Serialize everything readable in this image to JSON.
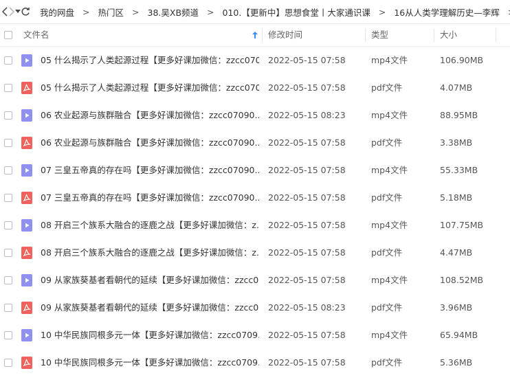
{
  "breadcrumb": [
    "我的网盘",
    "热门区",
    "38.吴XB频道",
    "010.【更新中】思想食堂丨大家通识课",
    "16从人类学理解历史—李辉"
  ],
  "columns": {
    "name": "文件名",
    "modified": "修改时间",
    "type": "类型",
    "size": "大小"
  },
  "files": [
    {
      "name": "05 什么揭示了人类起源过程【更多好课加微信：zzcc070...",
      "modified": "2022-05-15 07:58",
      "type": "mp4文件",
      "size": "106.90MB",
      "icon": "video-file-icon"
    },
    {
      "name": "05 什么揭示了人类起源过程【更多好课加微信：zzcc070...",
      "modified": "2022-05-15 07:58",
      "type": "pdf文件",
      "size": "4.07MB",
      "icon": "pdf-file-icon"
    },
    {
      "name": "06 农业起源与族群融合【更多好课加微信：zzcc07090...",
      "modified": "2022-05-15 08:23",
      "type": "mp4文件",
      "size": "88.95MB",
      "icon": "video-file-icon"
    },
    {
      "name": "06 农业起源与族群融合【更多好课加微信：zzcc07090...",
      "modified": "2022-05-15 07:58",
      "type": "pdf文件",
      "size": "3.38MB",
      "icon": "pdf-file-icon"
    },
    {
      "name": "07 三皇五帝真的存在吗【更多好课加微信：zzcc07090...",
      "modified": "2022-05-15 07:58",
      "type": "mp4文件",
      "size": "55.33MB",
      "icon": "video-file-icon"
    },
    {
      "name": "07 三皇五帝真的存在吗【更多好课加微信：zzcc07090...",
      "modified": "2022-05-15 07:58",
      "type": "pdf文件",
      "size": "5.18MB",
      "icon": "pdf-file-icon"
    },
    {
      "name": "08 开启三个族系大融合的逐鹿之战【更多好课加微信：z...",
      "modified": "2022-05-15 07:58",
      "type": "mp4文件",
      "size": "107.75MB",
      "icon": "video-file-icon"
    },
    {
      "name": "08 开启三个族系大融合的逐鹿之战【更多好课加微信：z...",
      "modified": "2022-05-15 07:58",
      "type": "pdf文件",
      "size": "4.47MB",
      "icon": "pdf-file-icon"
    },
    {
      "name": "09 从家族葵基者看朝代的延续【更多好课加微信：zzcc0...",
      "modified": "2022-05-15 07:58",
      "type": "mp4文件",
      "size": "108.52MB",
      "icon": "video-file-icon"
    },
    {
      "name": "09 从家族葵基者看朝代的延续【更多好课加微信：zzcc0...",
      "modified": "2022-05-15 08:23",
      "type": "pdf文件",
      "size": "3.96MB",
      "icon": "pdf-file-icon"
    },
    {
      "name": "10 中华民族同根多元一体【更多好课加微信：zzcc0709...",
      "modified": "2022-05-15 07:58",
      "type": "mp4文件",
      "size": "65.94MB",
      "icon": "video-file-icon"
    },
    {
      "name": "10 中华民族同根多元一体【更多好课加微信：zzcc0709...",
      "modified": "2022-05-15 07:58",
      "type": "pdf文件",
      "size": "5.36MB",
      "icon": "pdf-file-icon"
    }
  ]
}
